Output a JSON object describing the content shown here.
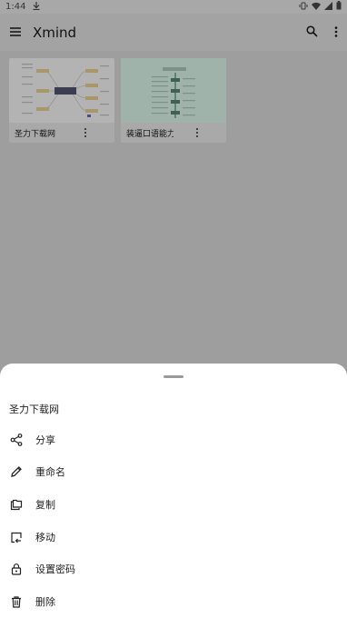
{
  "status_bar": {
    "time": "1:44",
    "download_icon": "download-arrow-icon"
  },
  "app_bar": {
    "title": "Xmind",
    "menu_icon": "hamburger-menu-icon",
    "search_icon": "search-icon",
    "more_icon": "more-vert-icon"
  },
  "files": [
    {
      "name": "圣力下载网",
      "thumb_color": "#b3b3b3",
      "thumb_center_label": "圣力下载网"
    },
    {
      "name": "装逼口语能力",
      "thumb_color": "#a0b3ab",
      "thumb_center_label": "装逼口语能力"
    }
  ],
  "sheet": {
    "title": "圣力下载网",
    "items": [
      {
        "label": "分享",
        "icon": "share-icon"
      },
      {
        "label": "重命名",
        "icon": "pencil-icon"
      },
      {
        "label": "复制",
        "icon": "copy-icon"
      },
      {
        "label": "移动",
        "icon": "move-icon"
      },
      {
        "label": "设置密码",
        "icon": "lock-icon"
      },
      {
        "label": "删除",
        "icon": "trash-icon"
      }
    ]
  },
  "colors": {
    "scrim": "#9e9e9e",
    "sheet_bg": "#ffffff",
    "text": "#222222"
  }
}
